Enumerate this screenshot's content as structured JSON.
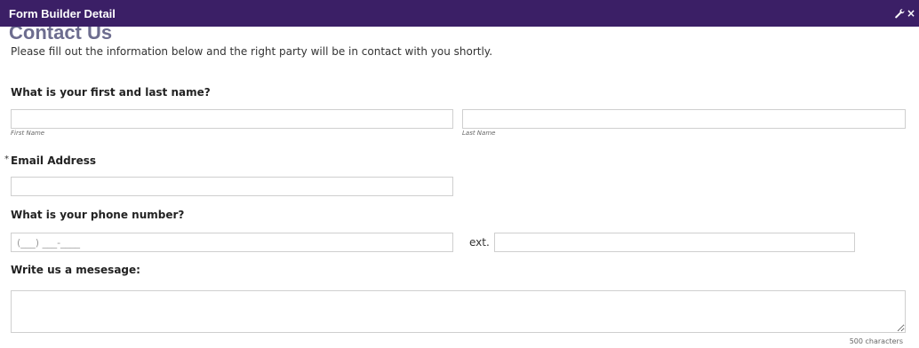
{
  "window": {
    "title": "Form Builder Detail",
    "close_glyph": "×",
    "obscured_heading": "Contact Us"
  },
  "form": {
    "intro": "Please fill out the information below and the right party will be in contact with you shortly.",
    "name_question": "What is your first and last name?",
    "first_name_sublabel": "First Name",
    "last_name_sublabel": "Last Name",
    "first_name_value": "",
    "last_name_value": "",
    "email_tick": "*",
    "email_label": "Email Address",
    "email_value": "",
    "phone_question": "What is your phone number?",
    "phone_placeholder": "(___) ___-____",
    "phone_value": "",
    "ext_label": "ext.",
    "ext_value": "",
    "message_question": "Write us a mesesage:",
    "message_value": "",
    "char_counter": "500 characters"
  },
  "icons": {
    "settings": "wrench-icon",
    "close": "close-icon"
  },
  "colors": {
    "titlebar_bg": "#3b1f66",
    "titlebar_text": "#ffffff",
    "input_border": "#cfcfcf"
  }
}
